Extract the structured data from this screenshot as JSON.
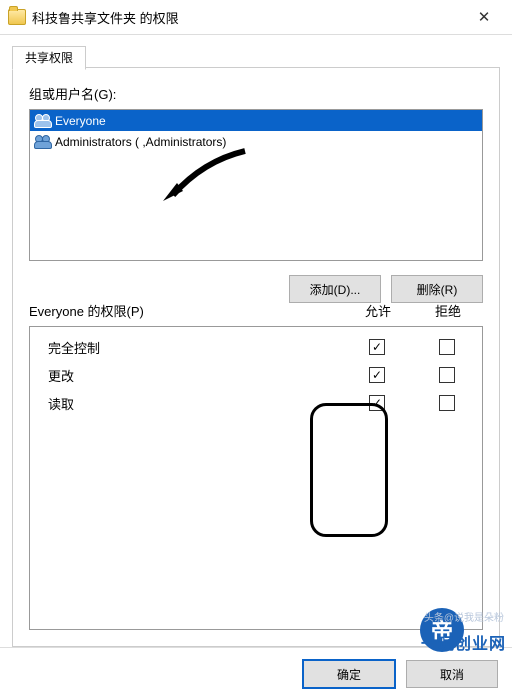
{
  "title": "科技鲁共享文件夹 的权限",
  "tab": "共享权限",
  "groups_label": "组或用户名(G):",
  "users": [
    {
      "name": "Everyone",
      "selected": true
    },
    {
      "name": "Administrators (           ,Administrators)",
      "selected": false
    }
  ],
  "add_btn": "添加(D)...",
  "remove_btn": "删除(R)",
  "perm_for_label": "Everyone 的权限(P)",
  "col_allow": "允许",
  "col_deny": "拒绝",
  "perms": [
    {
      "name": "完全控制",
      "allow": true,
      "deny": false
    },
    {
      "name": "更改",
      "allow": true,
      "deny": false
    },
    {
      "name": "读取",
      "allow": true,
      "deny": false
    }
  ],
  "ok": "确定",
  "cancel": "取消",
  "watermark": {
    "circle": "帝",
    "small1": "头条@说我是朵粉",
    "main": "一玩创业网"
  }
}
